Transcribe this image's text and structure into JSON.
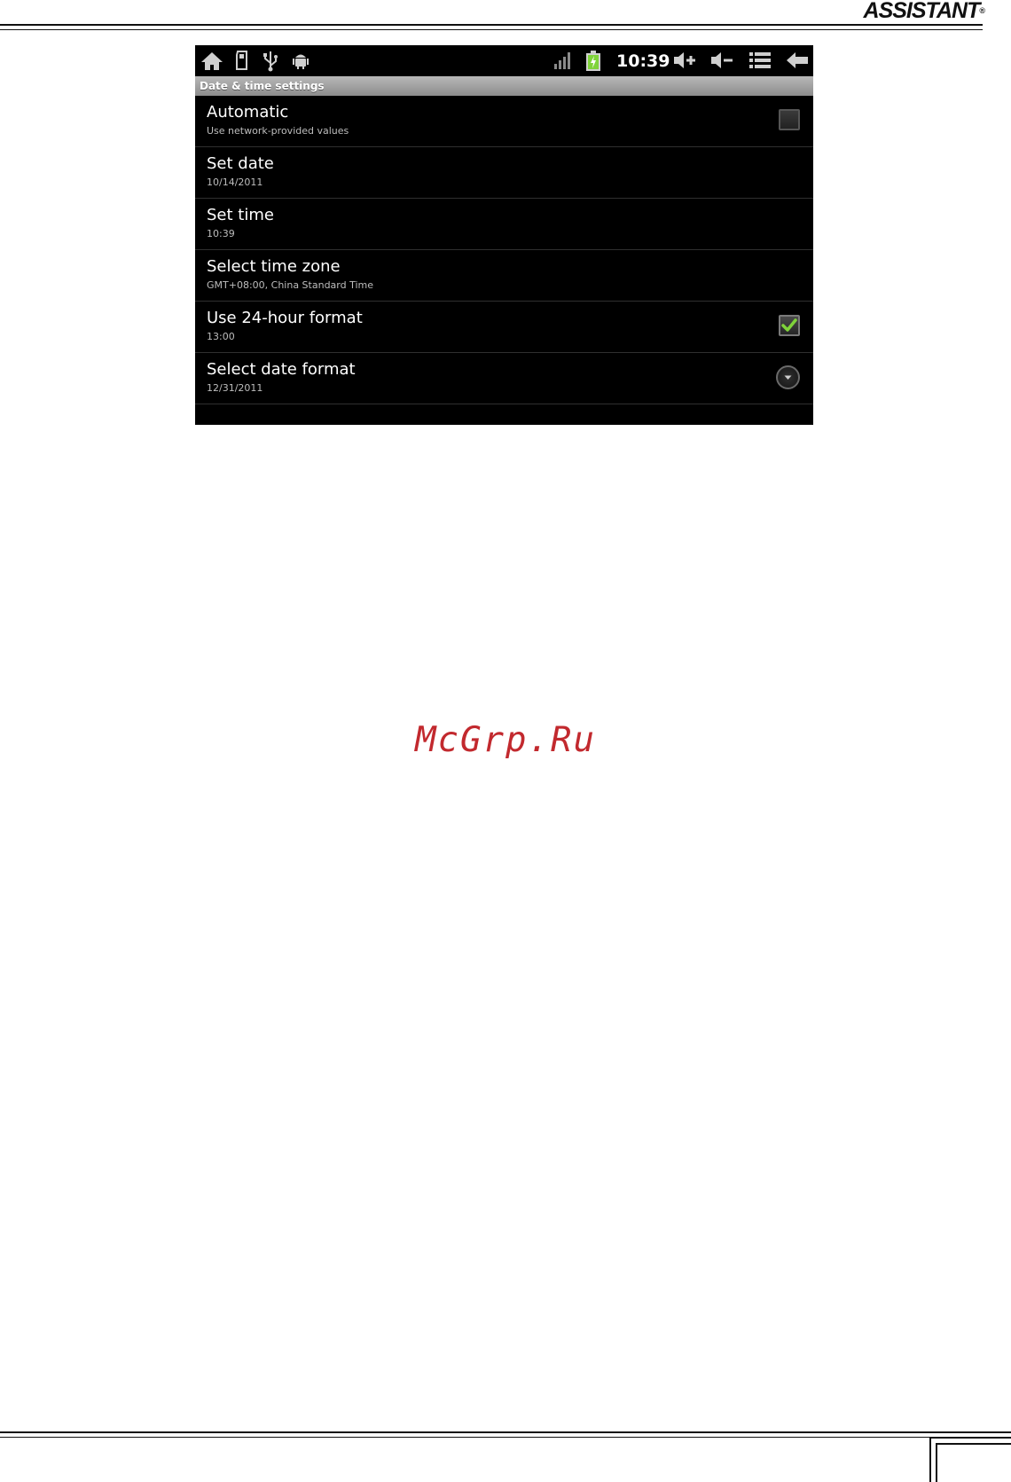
{
  "document": {
    "brand": "ASSISTANT",
    "brand_mark": "®",
    "watermark": "McGrp.Ru"
  },
  "statusbar": {
    "clock": "10:39",
    "left_icons": [
      "home-icon",
      "sd-card-icon",
      "usb-icon",
      "android-debug-icon"
    ],
    "right_icons": [
      "signal-icon",
      "battery-charging-icon",
      "volume-up-icon",
      "volume-down-icon",
      "menu-icon",
      "back-icon"
    ]
  },
  "screen": {
    "title": "Date & time settings",
    "settings": [
      {
        "title": "Automatic",
        "summary": "Use network-provided values",
        "control": "checkbox",
        "checked": false
      },
      {
        "title": "Set date",
        "summary": "10/14/2011",
        "control": "none"
      },
      {
        "title": "Set time",
        "summary": "10:39",
        "control": "none"
      },
      {
        "title": "Select time zone",
        "summary": "GMT+08:00, China Standard Time",
        "control": "none"
      },
      {
        "title": "Use 24-hour format",
        "summary": "13:00",
        "control": "checkbox",
        "checked": true
      },
      {
        "title": "Select date format",
        "summary": "12/31/2011",
        "control": "dropdown"
      }
    ]
  },
  "colors": {
    "accent_check": "#7fd33a",
    "watermark": "#c2292e",
    "battery_green": "#7fd33a"
  }
}
